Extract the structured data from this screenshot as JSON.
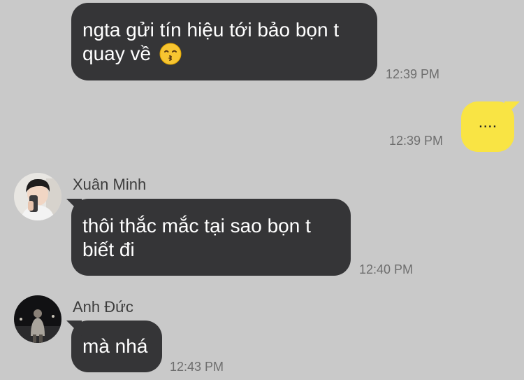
{
  "messages": [
    {
      "text_line1": "ngta gửi tín hiệu tới bảo bọn t",
      "text_line2": "quay về",
      "emoji": "kissing-face-emoji",
      "time": "12:39 PM"
    },
    {
      "text": "....",
      "time": "12:39 PM"
    },
    {
      "sender": "Xuân Minh",
      "text_line1": "thôi thắc mắc tại sao bọn t",
      "text_line2": "biết đi",
      "time": "12:40 PM"
    },
    {
      "sender": "Anh Đức",
      "text": "mà nhá",
      "time": "12:43 PM"
    }
  ],
  "colors": {
    "background": "#c9c9c9",
    "incoming_bubble": "#353537",
    "outgoing_bubble": "#f9e444",
    "timestamp": "#6e6e6e"
  }
}
